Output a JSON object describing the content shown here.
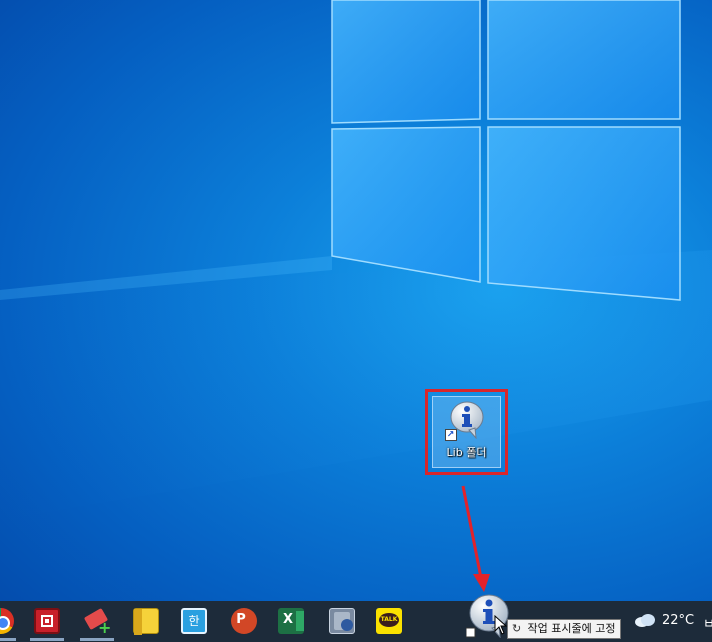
{
  "desktop": {
    "shortcut": {
      "label": "Lib 폴더",
      "icon": "info-bubble-icon"
    }
  },
  "taskbar": {
    "apps": [
      {
        "name": "chrome-icon",
        "color": "#d93025"
      },
      {
        "name": "red-square-app-icon",
        "color": "#c8202a"
      },
      {
        "name": "eraser-plus-app-icon",
        "color": "#e34b4b"
      },
      {
        "name": "sticky-notes-icon",
        "color": "#f6d23a"
      },
      {
        "name": "hancom-app-icon",
        "color": "#2aa0e0"
      },
      {
        "name": "powerpoint-icon",
        "color": "#d24726"
      },
      {
        "name": "excel-icon",
        "color": "#1d7044"
      },
      {
        "name": "recycle-app-icon",
        "color": "#7a8aa0"
      },
      {
        "name": "kakaotalk-icon",
        "color": "#fae100"
      }
    ],
    "kakao_label": "TALK",
    "hancom_label": "한",
    "ppt_label": "P",
    "excel_label": "X",
    "tooltip": {
      "icon": "pin-icon",
      "text": "작업 표시줄에 고정"
    },
    "weather": {
      "temp": "22°C",
      "text": "ㅂ",
      "icon": "cloud-icon"
    }
  },
  "colors": {
    "highlight": "#d8262b",
    "taskbar_bg": "#1d2b3a"
  }
}
